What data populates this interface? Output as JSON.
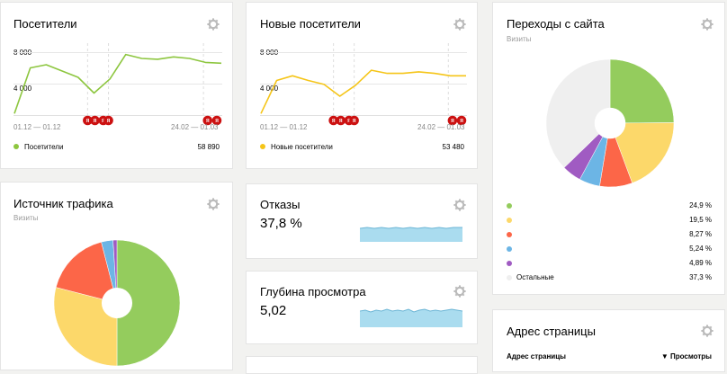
{
  "visitors": {
    "title": "Посетители",
    "y_ticks": [
      "8 000",
      "4 000"
    ],
    "x_left": "01.12 — 01.12",
    "x_right": "24.02 — 01.03",
    "legend_label": "Посетители",
    "legend_value": "58 890",
    "color": "#8dc63f"
  },
  "new_visitors": {
    "title": "Новые посетители",
    "y_ticks": [
      "8 000",
      "4 000"
    ],
    "x_left": "01.12 — 01.12",
    "x_right": "24.02 — 01.03",
    "legend_label": "Новые посетители",
    "legend_value": "53 480",
    "color": "#f5c518"
  },
  "referrals": {
    "title": "Переходы с сайта",
    "subtitle": "Визиты",
    "rows": [
      {
        "color": "#94cc5d",
        "label": "",
        "value": "24,9 %"
      },
      {
        "color": "#fcd86a",
        "label": "",
        "value": "19,5 %"
      },
      {
        "color": "#fc6648",
        "label": "",
        "value": "8,27 %"
      },
      {
        "color": "#6cb5e5",
        "label": "",
        "value": "5,24 %"
      },
      {
        "color": "#a05bc2",
        "label": "",
        "value": "4,89 %"
      },
      {
        "color": "#efefef",
        "label": "Остальные",
        "value": "37,3 %"
      }
    ]
  },
  "traffic_source": {
    "title": "Источник трафика",
    "subtitle": "Визиты",
    "slices": [
      {
        "color": "#94cc5d",
        "value": 50
      },
      {
        "color": "#fcd86a",
        "value": 29
      },
      {
        "color": "#fc6648",
        "value": 17
      },
      {
        "color": "#6cb5e5",
        "value": 3
      },
      {
        "color": "#a05bc2",
        "value": 1
      }
    ]
  },
  "bounces": {
    "title": "Отказы",
    "value": "37,8 %"
  },
  "depth": {
    "title": "Глубина просмотра",
    "value": "5,02"
  },
  "page_address": {
    "title": "Адрес страницы",
    "col_page": "Адрес страницы",
    "col_views": "▼ Просмотры"
  },
  "chart_data": [
    {
      "type": "line",
      "series": [
        {
          "name": "Посетители",
          "values": [
            200,
            6000,
            6400,
            5600,
            4800,
            2800,
            4600,
            7700,
            7200,
            7100,
            7400,
            7200,
            6700,
            6600
          ]
        }
      ],
      "ylim": [
        0,
        8000
      ]
    },
    {
      "type": "line",
      "series": [
        {
          "name": "Новые посетители",
          "values": [
            200,
            4400,
            5000,
            4400,
            3900,
            2400,
            3800,
            5700,
            5300,
            5300,
            5500,
            5300,
            5000,
            5000
          ]
        }
      ],
      "ylim": [
        0,
        8000
      ]
    },
    {
      "type": "pie",
      "values": [
        24.9,
        19.5,
        8.27,
        5.24,
        4.89,
        37.3
      ]
    },
    {
      "type": "pie",
      "values": [
        50,
        29,
        17,
        3,
        1
      ]
    }
  ]
}
